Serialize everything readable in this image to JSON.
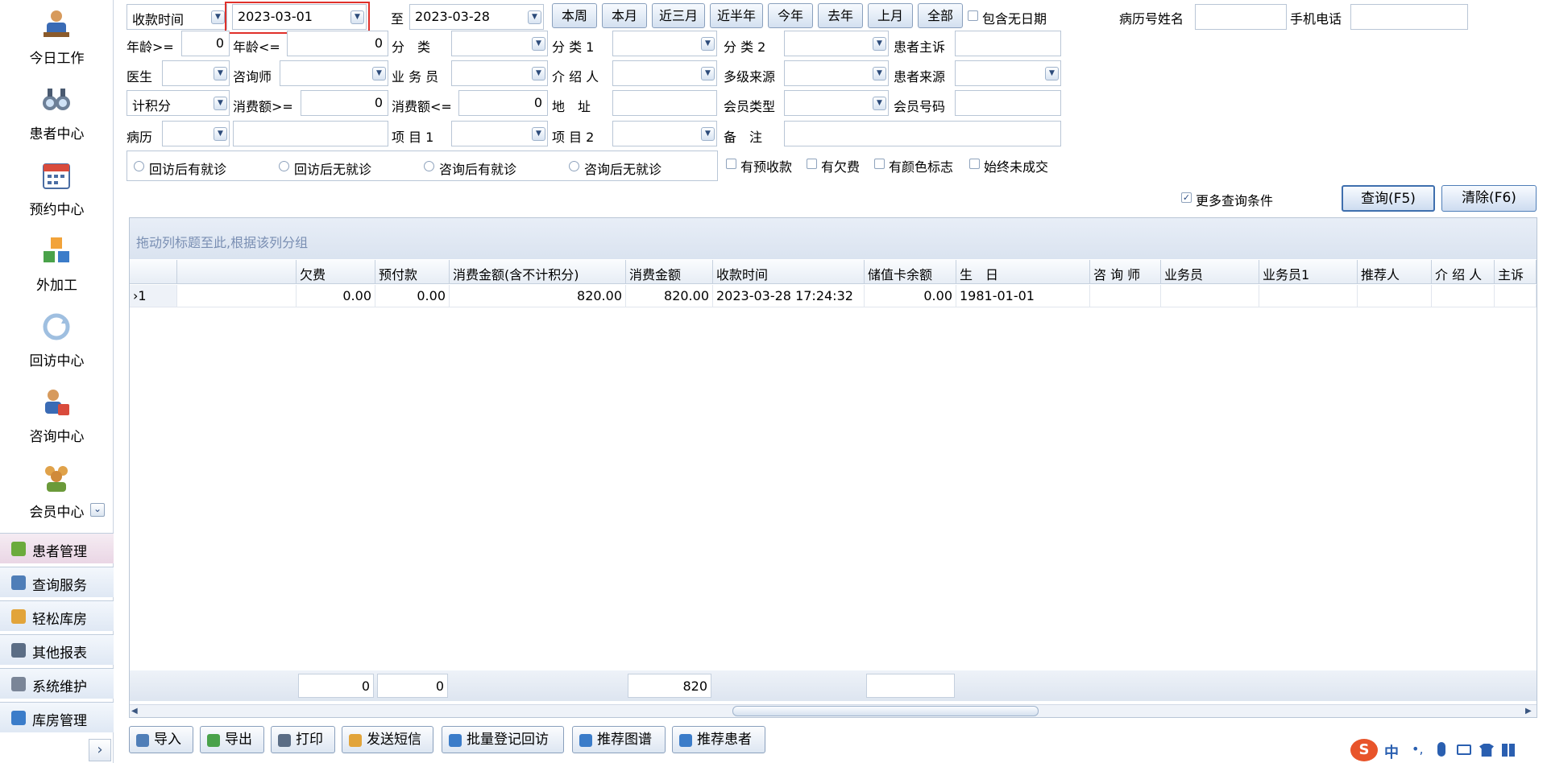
{
  "sidebar": {
    "nav": [
      {
        "label": "今日工作",
        "icon": "worker-icon"
      },
      {
        "label": "患者中心",
        "icon": "binoculars-icon"
      },
      {
        "label": "预约中心",
        "icon": "calendar-icon"
      },
      {
        "label": "外加工",
        "icon": "cubes-icon"
      },
      {
        "label": "回访中心",
        "icon": "refresh-icon"
      },
      {
        "label": "咨询中心",
        "icon": "consultant-icon"
      },
      {
        "label": "会员中心",
        "icon": "members-icon"
      }
    ],
    "categories": [
      {
        "label": "患者管理",
        "icon": "patients-icon"
      },
      {
        "label": "查询服务",
        "icon": "query-icon"
      },
      {
        "label": "轻松库房",
        "icon": "warehouse-icon"
      },
      {
        "label": "其他报表",
        "icon": "report-icon"
      },
      {
        "label": "系统维护",
        "icon": "gears-icon"
      },
      {
        "label": "库房管理",
        "icon": "storage-icon"
      }
    ],
    "expand_glyph": "›",
    "collapse_glyph": "⌄"
  },
  "filters": {
    "date_type": "收款时间",
    "date_from": "2023-03-01",
    "to_label": "至",
    "date_to": "2023-03-28",
    "quick_buttons": [
      "本周",
      "本月",
      "近三月",
      "近半年",
      "今年",
      "去年",
      "上月",
      "全部"
    ],
    "include_no_date": "包含无日期",
    "record_name_label": "病历号姓名",
    "phone_label": "手机电话",
    "age_ge_label": "年龄>=",
    "age_ge_value": "0",
    "age_le_label": "年龄<=",
    "age_le_value": "0",
    "category_label": "分　类",
    "category1_label": "分 类 1",
    "category2_label": "分 类 2",
    "complaint_label": "患者主诉",
    "doctor_label": "医生",
    "consultant_label": "咨询师",
    "salesman_label": "业 务 员",
    "introducer_label": "介 绍 人",
    "multi_source_label": "多级来源",
    "patient_source_label": "患者来源",
    "points_mode": "计积分",
    "spend_ge_label": "消费额>=",
    "spend_ge_value": "0",
    "spend_le_label": "消费额<=",
    "spend_le_value": "0",
    "address_label": "地　址",
    "member_type_label": "会员类型",
    "member_no_label": "会员号码",
    "record_label": "病历",
    "item1_label": "项 目 1",
    "item2_label": "项 目 2",
    "remark_label": "备　注",
    "radios": [
      "回访后有就诊",
      "回访后无就诊",
      "咨询后有就诊",
      "咨询后无就诊"
    ],
    "checks": [
      "有预收款",
      "有欠费",
      "有颜色标志",
      "始终未成交"
    ],
    "more_conditions": "更多查询条件",
    "query_button": "查询(F5)",
    "clear_button": "清除(F6)"
  },
  "grid": {
    "group_hint": "拖动列标题至此,根据该列分组",
    "columns": [
      "",
      "",
      "欠费",
      "预付款",
      "消费金额(含不计积分)",
      "消费金额",
      "收款时间",
      "储值卡余额",
      "生　日",
      "咨 询 师",
      "业务员",
      "业务员1",
      "推荐人",
      "介 绍 人",
      "主诉"
    ],
    "rows": [
      {
        "indicator": "›1",
        "name": "",
        "arrears": "0.00",
        "prepaid": "0.00",
        "spend_all": "820.00",
        "spend": "820.00",
        "pay_time": "2023-03-28 17:24:32",
        "card_balance": "0.00",
        "birthday": "1981-01-01",
        "consultant": "",
        "salesman": "",
        "salesman1": "",
        "referrer": "",
        "introducer": "",
        "complaint": ""
      }
    ],
    "footer": {
      "arrears": "0",
      "prepaid": "0",
      "spend": "820",
      "card_balance": ""
    }
  },
  "toolbar": {
    "buttons": [
      {
        "label": "导入",
        "icon": "import-icon"
      },
      {
        "label": "导出",
        "icon": "export-icon"
      },
      {
        "label": "打印",
        "icon": "printer-icon"
      },
      {
        "label": "发送短信",
        "icon": "sms-icon"
      },
      {
        "label": "批量登记回访",
        "icon": "batch-followup-icon"
      },
      {
        "label": "推荐图谱",
        "icon": "graph-icon"
      },
      {
        "label": "推荐患者",
        "icon": "recommend-icon"
      }
    ]
  },
  "ime": {
    "lang": "中",
    "punct": "•,"
  },
  "colors": {
    "accent": "#4f7eb8",
    "highlight_border": "#e0302a",
    "ime_brand": "#e8542a"
  }
}
